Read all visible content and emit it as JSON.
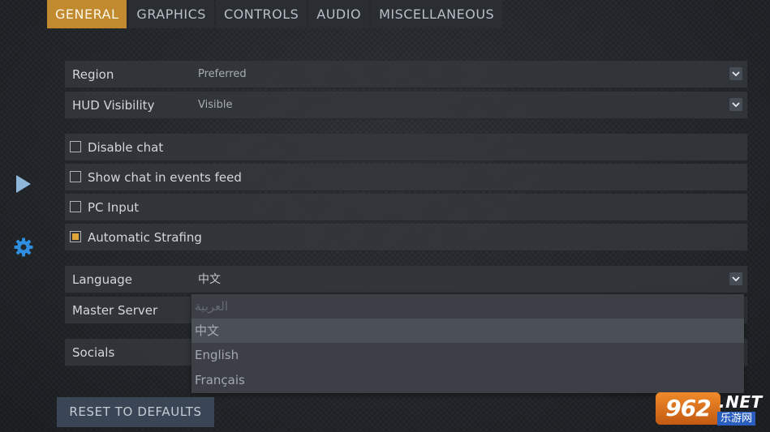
{
  "tabs": [
    {
      "label": "GENERAL",
      "active": true
    },
    {
      "label": "GRAPHICS",
      "active": false
    },
    {
      "label": "CONTROLS",
      "active": false
    },
    {
      "label": "AUDIO",
      "active": false
    },
    {
      "label": "MISCELLANEOUS",
      "active": false
    }
  ],
  "sidebar": {
    "play_icon": "play-icon",
    "settings_icon": "gear-icon"
  },
  "settings": {
    "region": {
      "label": "Region",
      "value": "Preferred"
    },
    "hud_visibility": {
      "label": "HUD Visibility",
      "value": "Visible"
    },
    "disable_chat": {
      "label": "Disable chat",
      "checked": false
    },
    "show_chat_events": {
      "label": "Show chat in events feed",
      "checked": false
    },
    "pc_input": {
      "label": "PC Input",
      "checked": false
    },
    "automatic_strafing": {
      "label": "Automatic Strafing",
      "checked": true
    },
    "language": {
      "label": "Language",
      "value": "中文"
    },
    "master_server": {
      "label": "Master Server"
    },
    "socials": {
      "label": "Socials"
    }
  },
  "language_dropdown": {
    "options": [
      "العربية",
      "中文",
      "English",
      "Français"
    ],
    "highlighted": "中文"
  },
  "reset_label": "RESET TO DEFAULTS",
  "watermark": {
    "badge": "962",
    "suffix": ".NET",
    "sub": "乐游网"
  },
  "colors": {
    "accent": "#c18a2f",
    "checkbox_on": "#e0a63a",
    "icon_blue": "#2e8fe0",
    "reset_button": "#3a4656"
  }
}
